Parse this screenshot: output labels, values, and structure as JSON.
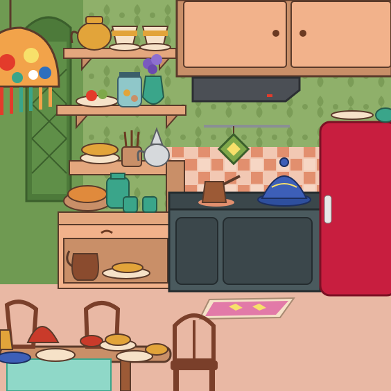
{
  "scene": {
    "type": "kitchen-room",
    "style": "cartoon-flat",
    "colors": {
      "wall": "#8fb06a",
      "wall_pattern": "#7b9c57",
      "floor": "#e9b8a4",
      "cabinet": "#e4a77e",
      "stove": "#4a5a5e",
      "fridge": "#c81e3f",
      "outline": "#5a3a2a",
      "wood_dark": "#7a3f2a",
      "teal_ceramic": "#3aa58a"
    },
    "objects": [
      {
        "id": "hanging-lamp",
        "icon": "mosaic-lamp-icon",
        "interactable": true
      },
      {
        "id": "window",
        "icon": "lattice-window-icon",
        "interactable": false
      },
      {
        "id": "wall-shelf-top",
        "icon": "shelf-icon",
        "interactable": false
      },
      {
        "id": "teapot",
        "icon": "teapot-icon",
        "interactable": true
      },
      {
        "id": "tea-cup-1",
        "icon": "cup-icon",
        "interactable": true
      },
      {
        "id": "tea-cup-2",
        "icon": "cup-icon",
        "interactable": true
      },
      {
        "id": "wall-shelf-middle",
        "icon": "shelf-icon",
        "interactable": false
      },
      {
        "id": "flower-vase",
        "icon": "vase-icon",
        "interactable": true
      },
      {
        "id": "spice-jar",
        "icon": "jar-icon",
        "interactable": true
      },
      {
        "id": "fruit-plate",
        "icon": "plate-icon",
        "interactable": true
      },
      {
        "id": "upper-cabinets",
        "icon": "cabinet-icon",
        "interactable": true
      },
      {
        "id": "range-hood",
        "icon": "hood-icon",
        "interactable": false
      },
      {
        "id": "hanging-pot-holder",
        "icon": "pot-holder-icon",
        "interactable": true
      },
      {
        "id": "sideboard",
        "icon": "sideboard-icon",
        "interactable": true
      },
      {
        "id": "bread-basket",
        "icon": "bread-icon",
        "interactable": true
      },
      {
        "id": "teal-kettle",
        "icon": "kettle-icon",
        "interactable": true
      },
      {
        "id": "utensil-holder",
        "icon": "utensils-icon",
        "interactable": true
      },
      {
        "id": "silver-teapot",
        "icon": "teapot-icon",
        "interactable": true
      },
      {
        "id": "clay-jug",
        "icon": "jug-icon",
        "interactable": true
      },
      {
        "id": "stove",
        "icon": "stove-icon",
        "interactable": true
      },
      {
        "id": "coffee-pot",
        "icon": "cezve-icon",
        "interactable": true
      },
      {
        "id": "tagine",
        "icon": "tagine-icon",
        "interactable": true
      },
      {
        "id": "fridge",
        "icon": "fridge-icon",
        "interactable": true
      },
      {
        "id": "floor-rug",
        "icon": "rug-icon",
        "interactable": true
      },
      {
        "id": "dining-table",
        "icon": "table-icon",
        "interactable": true
      },
      {
        "id": "chair",
        "icon": "chair-icon",
        "interactable": true
      }
    ]
  }
}
